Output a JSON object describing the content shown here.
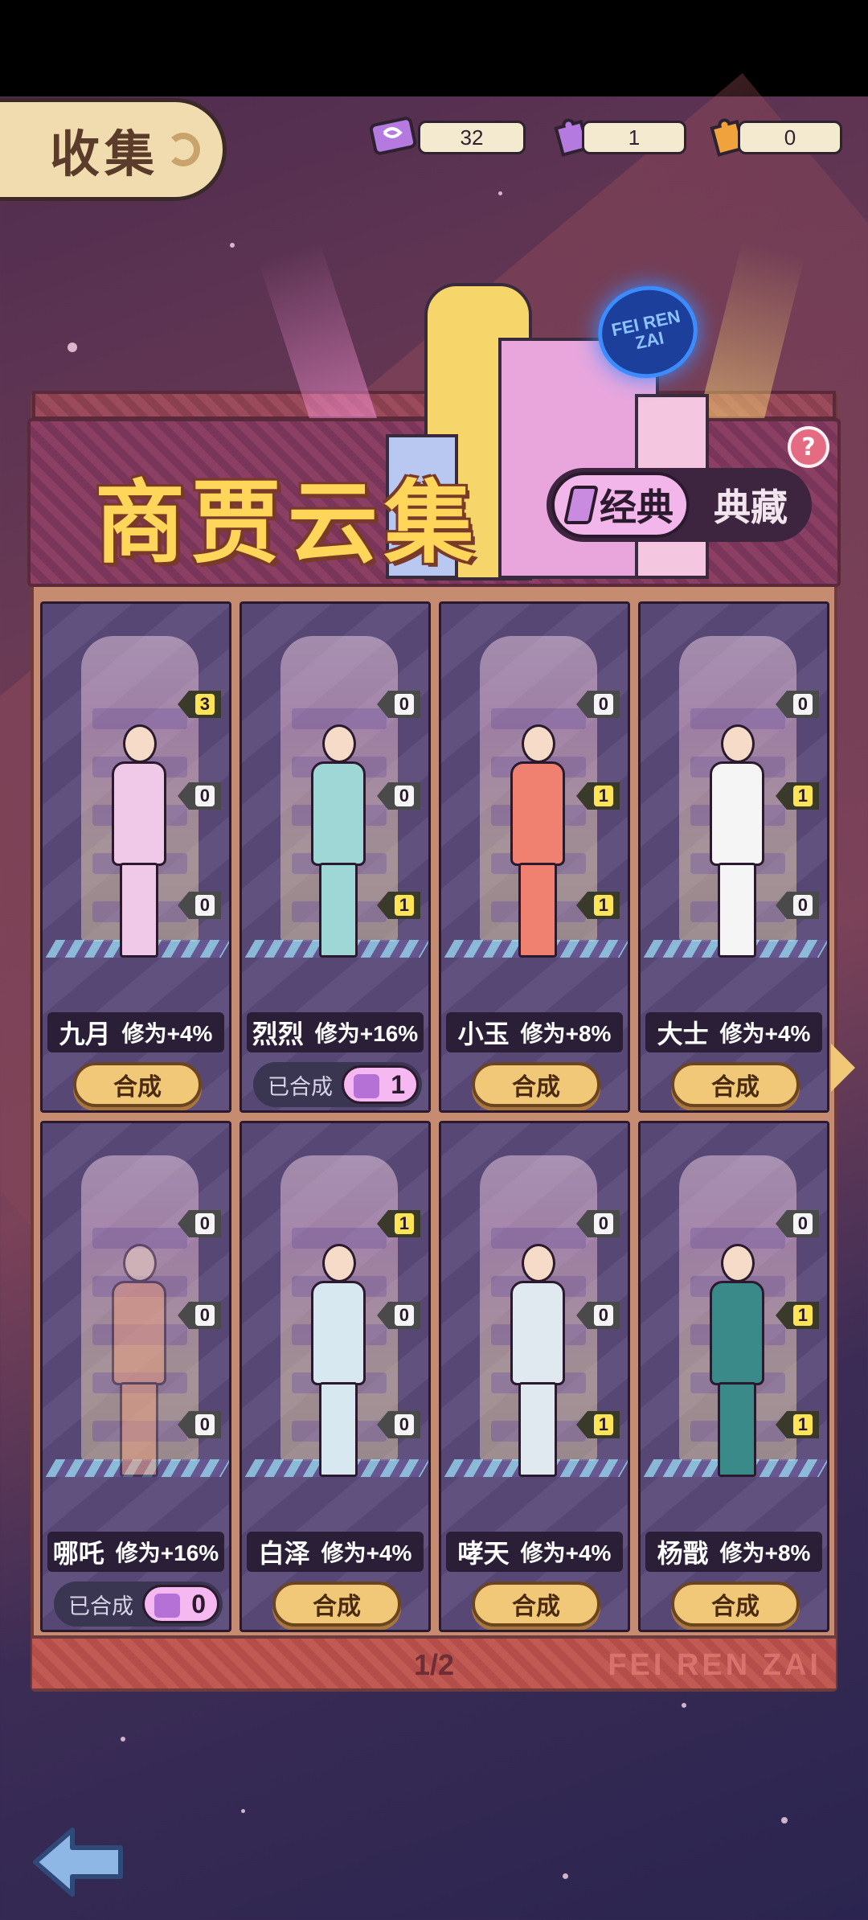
{
  "header": {
    "tab_label": "收集",
    "currencies": [
      {
        "icon": "ticket-icon",
        "value": "32",
        "color": "#b47ae0"
      },
      {
        "icon": "purple-puzzle-icon",
        "value": "1",
        "color": "#b47ae0"
      },
      {
        "icon": "orange-puzzle-icon",
        "value": "0",
        "color": "#f0a23c"
      }
    ]
  },
  "banner": {
    "title": "商贾云集",
    "help_icon": "question-icon",
    "help_label": "?",
    "neon_sign": "FEI REN ZAI",
    "segments": {
      "active": "经典",
      "inactive": "典藏"
    }
  },
  "cards": [
    {
      "name": "九月",
      "bonus": "修为+4%",
      "counts": [
        "3",
        "0",
        "0"
      ],
      "state": "synth",
      "button": "合成",
      "color": "#f0c8e8"
    },
    {
      "name": "烈烈",
      "bonus": "修为+16%",
      "counts": [
        "0",
        "0",
        "1"
      ],
      "state": "done",
      "done_label": "已合成",
      "done_count": "1",
      "color": "#9fd6d6"
    },
    {
      "name": "小玉",
      "bonus": "修为+8%",
      "counts": [
        "0",
        "1",
        "1"
      ],
      "state": "synth",
      "button": "合成",
      "color": "#f08070"
    },
    {
      "name": "大士",
      "bonus": "修为+4%",
      "counts": [
        "0",
        "1",
        "0"
      ],
      "state": "synth",
      "button": "合成",
      "color": "#f5f5f5"
    },
    {
      "name": "哪吒",
      "bonus": "修为+16%",
      "counts": [
        "0",
        "0",
        "0"
      ],
      "state": "done",
      "done_label": "已合成",
      "done_count": "0",
      "color": "#f0a080"
    },
    {
      "name": "白泽",
      "bonus": "修为+4%",
      "counts": [
        "1",
        "0",
        "0"
      ],
      "state": "synth",
      "button": "合成",
      "color": "#d8e8f0"
    },
    {
      "name": "哮天",
      "bonus": "修为+4%",
      "counts": [
        "0",
        "0",
        "1"
      ],
      "state": "synth",
      "button": "合成",
      "color": "#e0e8f0"
    },
    {
      "name": "杨戬",
      "bonus": "修为+8%",
      "counts": [
        "0",
        "1",
        "1"
      ],
      "state": "synth",
      "button": "合成",
      "color": "#3a8a8a"
    }
  ],
  "pager": {
    "page": "1/2",
    "watermark": "FEI REN ZAI"
  },
  "nav": {
    "back_icon": "back-arrow-icon",
    "next_icon": "next-page-icon"
  }
}
